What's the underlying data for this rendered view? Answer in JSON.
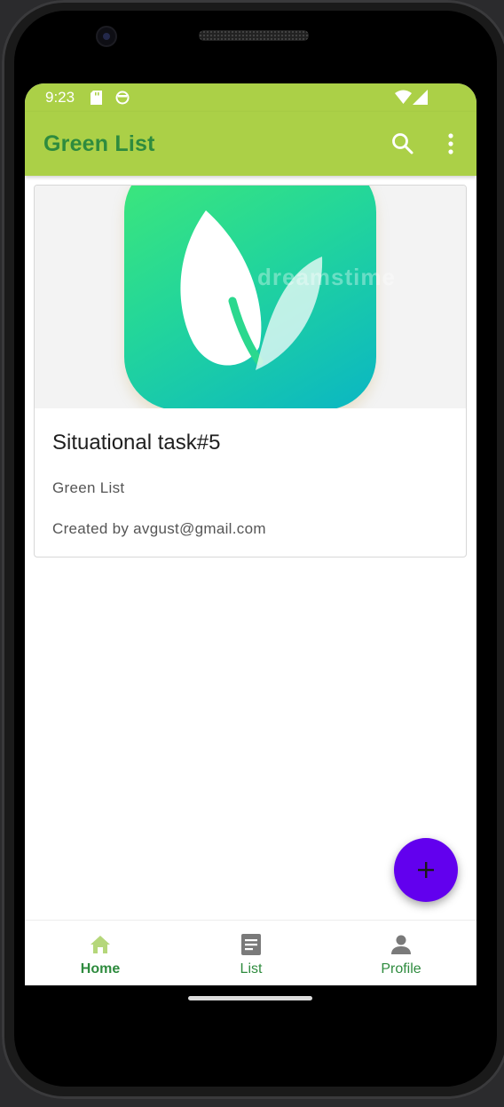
{
  "status_bar": {
    "time": "9:23",
    "icons": [
      "sd-card-icon",
      "face-icon",
      "wifi-icon",
      "signal-icon"
    ]
  },
  "app_bar": {
    "title": "Green List",
    "actions": [
      "search-icon",
      "more-vert-icon"
    ]
  },
  "card": {
    "image_watermark": "dreamstime",
    "title": "Situational task#5",
    "subtitle": "Green List",
    "author": "Created by avgust@gmail.com"
  },
  "fab": {
    "icon": "add-icon"
  },
  "bottom_nav": {
    "items": [
      {
        "label": "Home",
        "icon": "home-icon",
        "selected": true
      },
      {
        "label": "List",
        "icon": "list-icon",
        "selected": false
      },
      {
        "label": "Profile",
        "icon": "person-icon",
        "selected": false
      }
    ]
  },
  "colors": {
    "app_bar": "#abd047",
    "title_text": "#2e8b3e",
    "fab": "#6200ee",
    "nav_selected_icon": "#b5d77a",
    "nav_icon": "#7a7a7a"
  }
}
